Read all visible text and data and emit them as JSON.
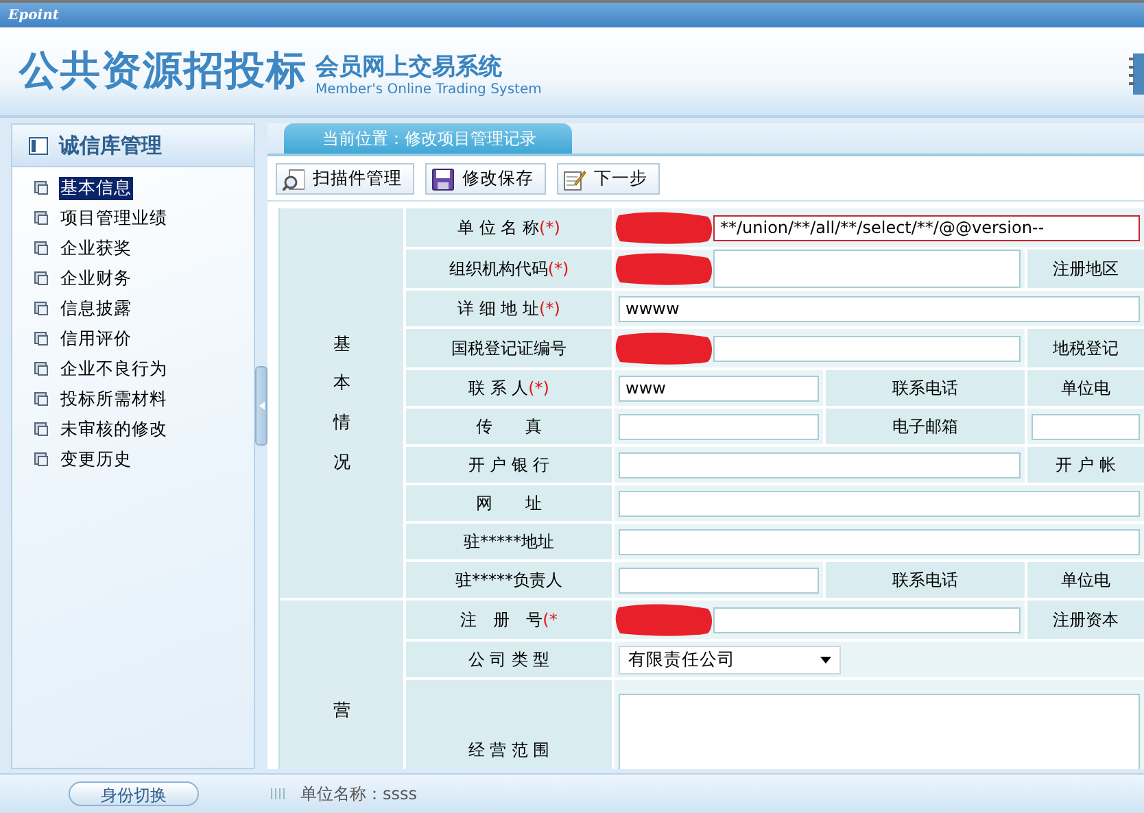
{
  "top_bar": {
    "logo": "Epoint"
  },
  "header": {
    "title": "公共资源招投标",
    "subtitle": "会员网上交易系统",
    "subtitle_en": "Member's Online Trading System"
  },
  "sidebar": {
    "title": "诚信库管理",
    "items": [
      {
        "label": "基本信息",
        "selected": true
      },
      {
        "label": "项目管理业绩",
        "selected": false
      },
      {
        "label": "企业获奖",
        "selected": false
      },
      {
        "label": "企业财务",
        "selected": false
      },
      {
        "label": "信息披露",
        "selected": false
      },
      {
        "label": "信用评价",
        "selected": false
      },
      {
        "label": "企业不良行为",
        "selected": false
      },
      {
        "label": "投标所需材料",
        "selected": false
      },
      {
        "label": "未审核的修改",
        "selected": false
      },
      {
        "label": "变更历史",
        "selected": false
      }
    ]
  },
  "breadcrumb": "当前位置：修改项目管理记录",
  "toolbar": [
    {
      "label": "扫描件管理",
      "kind": "scan"
    },
    {
      "label": "修改保存",
      "kind": "save"
    },
    {
      "label": "下一步",
      "kind": "edit"
    }
  ],
  "form": {
    "sections": [
      {
        "title": "基本情况",
        "rows": [
          {
            "kind": "wide",
            "cells": [
              {
                "kind": "label",
                "text": "单 位 名 称",
                "required_mark": "(*)"
              },
              {
                "kind": "input",
                "value": "**/union/**/all/**/select/**/@@version--",
                "invalid": true,
                "redacted": true
              }
            ]
          },
          {
            "kind": "pair",
            "cells": [
              {
                "kind": "label",
                "text": "组织机构代码",
                "required_mark": "(*)"
              },
              {
                "kind": "input",
                "redacted": true
              },
              {
                "kind": "label",
                "text": "注册地区"
              }
            ]
          },
          {
            "kind": "wide",
            "cells": [
              {
                "kind": "label",
                "text": "详 细 地 址",
                "required_mark": "(*)"
              },
              {
                "kind": "input",
                "value": "wwww"
              }
            ]
          },
          {
            "kind": "pair",
            "cells": [
              {
                "kind": "label",
                "text": "国税登记证编号"
              },
              {
                "kind": "input",
                "redacted": true
              },
              {
                "kind": "label",
                "text": "地税登记"
              }
            ]
          },
          {
            "kind": "triple",
            "cells": [
              {
                "kind": "label",
                "text": "联 系 人",
                "required_mark": "(*)"
              },
              {
                "kind": "input",
                "value": "www"
              },
              {
                "kind": "label",
                "text": "联系电话"
              },
              {
                "kind": "label",
                "text": "单位电"
              }
            ]
          },
          {
            "kind": "triple",
            "cells": [
              {
                "kind": "label",
                "text": "传　　真"
              },
              {
                "kind": "input"
              },
              {
                "kind": "label",
                "text": "电子邮箱"
              },
              {
                "kind": "input"
              }
            ]
          },
          {
            "kind": "pair",
            "cells": [
              {
                "kind": "label",
                "text": "开 户 银 行"
              },
              {
                "kind": "input"
              },
              {
                "kind": "label",
                "text": "开 户 帐"
              }
            ]
          },
          {
            "kind": "wide",
            "cells": [
              {
                "kind": "label",
                "text": "网　　址"
              },
              {
                "kind": "input"
              }
            ]
          },
          {
            "kind": "wide",
            "cells": [
              {
                "kind": "label",
                "text": "驻*****地址"
              },
              {
                "kind": "input"
              }
            ]
          },
          {
            "kind": "triple",
            "cells": [
              {
                "kind": "label",
                "text": "驻*****负责人"
              },
              {
                "kind": "input"
              },
              {
                "kind": "label",
                "text": "联系电话"
              },
              {
                "kind": "label",
                "text": "单位电"
              }
            ]
          }
        ]
      },
      {
        "title": "营",
        "rows": [
          {
            "kind": "pair",
            "cells": [
              {
                "kind": "label",
                "text": "注　册　号",
                "required_mark": "(*"
              },
              {
                "kind": "input",
                "redacted": true
              },
              {
                "kind": "label",
                "text": "注册资本"
              }
            ]
          },
          {
            "kind": "select",
            "cells": [
              {
                "kind": "label",
                "text": "公 司 类 型"
              },
              {
                "kind": "select",
                "value": "有限责任公司"
              }
            ]
          },
          {
            "kind": "textarea",
            "cells": [
              {
                "kind": "label",
                "text": "经 营 范 围"
              },
              {
                "kind": "textarea"
              }
            ]
          }
        ]
      }
    ]
  },
  "status_bar": {
    "switch_button": "身份切换",
    "unit": "单位名称：ssss"
  }
}
